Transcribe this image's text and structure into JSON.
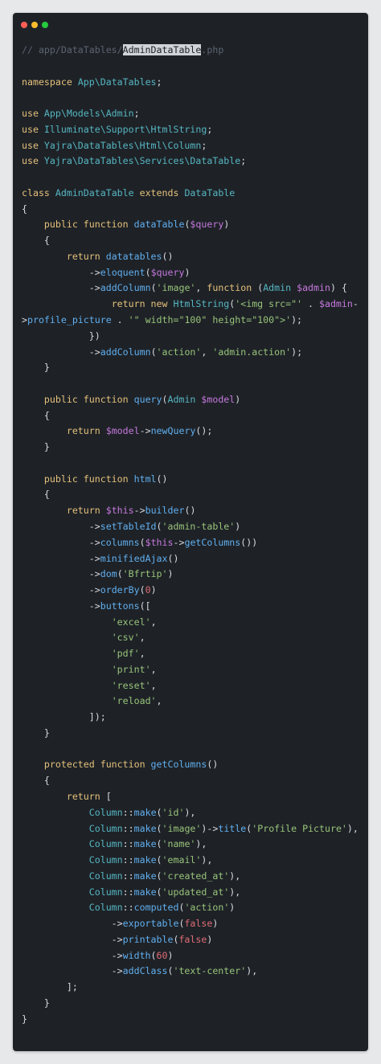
{
  "window": {
    "controls": [
      {
        "name": "close-dot",
        "color": "#ff5f56"
      },
      {
        "name": "minimize-dot",
        "color": "#ffbd2e"
      },
      {
        "name": "maximize-dot",
        "color": "#27c93f"
      }
    ]
  },
  "code": {
    "lines": [
      [
        [
          "comment",
          "// app/DataTables/"
        ],
        [
          "hl",
          "AdminDataTable"
        ],
        [
          "comment",
          ".php"
        ]
      ],
      [],
      [
        [
          "keyword",
          "namespace "
        ],
        [
          "ns",
          "App\\DataTables"
        ],
        [
          "default",
          ";"
        ]
      ],
      [],
      [
        [
          "keyword",
          "use "
        ],
        [
          "ns",
          "App\\Models\\Admin"
        ],
        [
          "default",
          ";"
        ]
      ],
      [
        [
          "keyword",
          "use "
        ],
        [
          "ns",
          "Illuminate\\Support\\HtmlString"
        ],
        [
          "default",
          ";"
        ]
      ],
      [
        [
          "keyword",
          "use "
        ],
        [
          "ns",
          "Yajra\\DataTables\\Html\\Column"
        ],
        [
          "default",
          ";"
        ]
      ],
      [
        [
          "keyword",
          "use "
        ],
        [
          "ns",
          "Yajra\\DataTables\\Services\\DataTable"
        ],
        [
          "default",
          ";"
        ]
      ],
      [],
      [
        [
          "keyword",
          "class "
        ],
        [
          "ns",
          "AdminDataTable "
        ],
        [
          "keyword",
          "extends "
        ],
        [
          "ns",
          "DataTable"
        ]
      ],
      [
        [
          "default",
          "{"
        ]
      ],
      [
        [
          "default",
          "    "
        ],
        [
          "keyword",
          "public function "
        ],
        [
          "func",
          "dataTable"
        ],
        [
          "default",
          "("
        ],
        [
          "var",
          "$query"
        ],
        [
          "default",
          ")"
        ]
      ],
      [
        [
          "default",
          "    {"
        ]
      ],
      [
        [
          "default",
          "        "
        ],
        [
          "keyword",
          "return "
        ],
        [
          "func",
          "datatables"
        ],
        [
          "default",
          "()"
        ]
      ],
      [
        [
          "default",
          "            ->"
        ],
        [
          "func",
          "eloquent"
        ],
        [
          "default",
          "("
        ],
        [
          "var",
          "$query"
        ],
        [
          "default",
          ")"
        ]
      ],
      [
        [
          "default",
          "            ->"
        ],
        [
          "func",
          "addColumn"
        ],
        [
          "default",
          "("
        ],
        [
          "str",
          "'image'"
        ],
        [
          "default",
          ", "
        ],
        [
          "keyword",
          "function "
        ],
        [
          "default",
          "("
        ],
        [
          "ns",
          "Admin "
        ],
        [
          "var",
          "$admin"
        ],
        [
          "default",
          ") {"
        ]
      ],
      [
        [
          "default",
          "                "
        ],
        [
          "keyword",
          "return new "
        ],
        [
          "ns",
          "HtmlString"
        ],
        [
          "default",
          "("
        ],
        [
          "str",
          "'<img src=\"'"
        ],
        [
          "default",
          " . "
        ],
        [
          "var",
          "$admin"
        ],
        [
          "default",
          "-"
        ]
      ],
      [
        [
          "default",
          ">"
        ],
        [
          "func",
          "profile_picture"
        ],
        [
          "default",
          " . "
        ],
        [
          "str",
          "'\" width=\"100\" height=\"100\">'"
        ],
        [
          "default",
          ");"
        ]
      ],
      [
        [
          "default",
          "            })"
        ]
      ],
      [
        [
          "default",
          "            ->"
        ],
        [
          "func",
          "addColumn"
        ],
        [
          "default",
          "("
        ],
        [
          "str",
          "'action'"
        ],
        [
          "default",
          ", "
        ],
        [
          "str",
          "'admin.action'"
        ],
        [
          "default",
          ");"
        ]
      ],
      [
        [
          "default",
          "    }"
        ]
      ],
      [],
      [
        [
          "default",
          "    "
        ],
        [
          "keyword",
          "public function "
        ],
        [
          "func",
          "query"
        ],
        [
          "default",
          "("
        ],
        [
          "ns",
          "Admin "
        ],
        [
          "var",
          "$model"
        ],
        [
          "default",
          ")"
        ]
      ],
      [
        [
          "default",
          "    {"
        ]
      ],
      [
        [
          "default",
          "        "
        ],
        [
          "keyword",
          "return "
        ],
        [
          "var",
          "$model"
        ],
        [
          "default",
          "->"
        ],
        [
          "func",
          "newQuery"
        ],
        [
          "default",
          "();"
        ]
      ],
      [
        [
          "default",
          "    }"
        ]
      ],
      [],
      [
        [
          "default",
          "    "
        ],
        [
          "keyword",
          "public function "
        ],
        [
          "func",
          "html"
        ],
        [
          "default",
          "()"
        ]
      ],
      [
        [
          "default",
          "    {"
        ]
      ],
      [
        [
          "default",
          "        "
        ],
        [
          "keyword",
          "return "
        ],
        [
          "var",
          "$this"
        ],
        [
          "default",
          "->"
        ],
        [
          "func",
          "builder"
        ],
        [
          "default",
          "()"
        ]
      ],
      [
        [
          "default",
          "            ->"
        ],
        [
          "func",
          "setTableId"
        ],
        [
          "default",
          "("
        ],
        [
          "str",
          "'admin-table'"
        ],
        [
          "default",
          ")"
        ]
      ],
      [
        [
          "default",
          "            ->"
        ],
        [
          "func",
          "columns"
        ],
        [
          "default",
          "("
        ],
        [
          "var",
          "$this"
        ],
        [
          "default",
          "->"
        ],
        [
          "func",
          "getColumns"
        ],
        [
          "default",
          "())"
        ]
      ],
      [
        [
          "default",
          "            ->"
        ],
        [
          "func",
          "minifiedAjax"
        ],
        [
          "default",
          "()"
        ]
      ],
      [
        [
          "default",
          "            ->"
        ],
        [
          "func",
          "dom"
        ],
        [
          "default",
          "("
        ],
        [
          "str",
          "'Bfrtip'"
        ],
        [
          "default",
          ")"
        ]
      ],
      [
        [
          "default",
          "            ->"
        ],
        [
          "func",
          "orderBy"
        ],
        [
          "default",
          "("
        ],
        [
          "num",
          "0"
        ],
        [
          "default",
          ")"
        ]
      ],
      [
        [
          "default",
          "            ->"
        ],
        [
          "func",
          "buttons"
        ],
        [
          "default",
          "(["
        ]
      ],
      [
        [
          "default",
          "                "
        ],
        [
          "str",
          "'excel'"
        ],
        [
          "default",
          ","
        ]
      ],
      [
        [
          "default",
          "                "
        ],
        [
          "str",
          "'csv'"
        ],
        [
          "default",
          ","
        ]
      ],
      [
        [
          "default",
          "                "
        ],
        [
          "str",
          "'pdf'"
        ],
        [
          "default",
          ","
        ]
      ],
      [
        [
          "default",
          "                "
        ],
        [
          "str",
          "'print'"
        ],
        [
          "default",
          ","
        ]
      ],
      [
        [
          "default",
          "                "
        ],
        [
          "str",
          "'reset'"
        ],
        [
          "default",
          ","
        ]
      ],
      [
        [
          "default",
          "                "
        ],
        [
          "str",
          "'reload'"
        ],
        [
          "default",
          ","
        ]
      ],
      [
        [
          "default",
          "            ]);"
        ]
      ],
      [
        [
          "default",
          "    }"
        ]
      ],
      [],
      [
        [
          "default",
          "    "
        ],
        [
          "keyword",
          "protected function "
        ],
        [
          "func",
          "getColumns"
        ],
        [
          "default",
          "()"
        ]
      ],
      [
        [
          "default",
          "    {"
        ]
      ],
      [
        [
          "default",
          "        "
        ],
        [
          "keyword",
          "return "
        ],
        [
          "default",
          "["
        ]
      ],
      [
        [
          "default",
          "            "
        ],
        [
          "ns",
          "Column"
        ],
        [
          "default",
          "::"
        ],
        [
          "func",
          "make"
        ],
        [
          "default",
          "("
        ],
        [
          "str",
          "'id'"
        ],
        [
          "default",
          "),"
        ]
      ],
      [
        [
          "default",
          "            "
        ],
        [
          "ns",
          "Column"
        ],
        [
          "default",
          "::"
        ],
        [
          "func",
          "make"
        ],
        [
          "default",
          "("
        ],
        [
          "str",
          "'image'"
        ],
        [
          "default",
          ")->"
        ],
        [
          "func",
          "title"
        ],
        [
          "default",
          "("
        ],
        [
          "str",
          "'Profile Picture'"
        ],
        [
          "default",
          "),"
        ]
      ],
      [
        [
          "default",
          "            "
        ],
        [
          "ns",
          "Column"
        ],
        [
          "default",
          "::"
        ],
        [
          "func",
          "make"
        ],
        [
          "default",
          "("
        ],
        [
          "str",
          "'name'"
        ],
        [
          "default",
          "),"
        ]
      ],
      [
        [
          "default",
          "            "
        ],
        [
          "ns",
          "Column"
        ],
        [
          "default",
          "::"
        ],
        [
          "func",
          "make"
        ],
        [
          "default",
          "("
        ],
        [
          "str",
          "'email'"
        ],
        [
          "default",
          "),"
        ]
      ],
      [
        [
          "default",
          "            "
        ],
        [
          "ns",
          "Column"
        ],
        [
          "default",
          "::"
        ],
        [
          "func",
          "make"
        ],
        [
          "default",
          "("
        ],
        [
          "str",
          "'created_at'"
        ],
        [
          "default",
          "),"
        ]
      ],
      [
        [
          "default",
          "            "
        ],
        [
          "ns",
          "Column"
        ],
        [
          "default",
          "::"
        ],
        [
          "func",
          "make"
        ],
        [
          "default",
          "("
        ],
        [
          "str",
          "'updated_at'"
        ],
        [
          "default",
          "),"
        ]
      ],
      [
        [
          "default",
          "            "
        ],
        [
          "ns",
          "Column"
        ],
        [
          "default",
          "::"
        ],
        [
          "func",
          "computed"
        ],
        [
          "default",
          "("
        ],
        [
          "str",
          "'action'"
        ],
        [
          "default",
          ")"
        ]
      ],
      [
        [
          "default",
          "                ->"
        ],
        [
          "func",
          "exportable"
        ],
        [
          "default",
          "("
        ],
        [
          "bool",
          "false"
        ],
        [
          "default",
          ")"
        ]
      ],
      [
        [
          "default",
          "                ->"
        ],
        [
          "func",
          "printable"
        ],
        [
          "default",
          "("
        ],
        [
          "bool",
          "false"
        ],
        [
          "default",
          ")"
        ]
      ],
      [
        [
          "default",
          "                ->"
        ],
        [
          "func",
          "width"
        ],
        [
          "default",
          "("
        ],
        [
          "num",
          "60"
        ],
        [
          "default",
          ")"
        ]
      ],
      [
        [
          "default",
          "                ->"
        ],
        [
          "func",
          "addClass"
        ],
        [
          "default",
          "("
        ],
        [
          "str",
          "'text-center'"
        ],
        [
          "default",
          "),"
        ]
      ],
      [
        [
          "default",
          "        ];"
        ]
      ],
      [
        [
          "default",
          "    }"
        ]
      ],
      [
        [
          "default",
          "}"
        ]
      ]
    ]
  }
}
